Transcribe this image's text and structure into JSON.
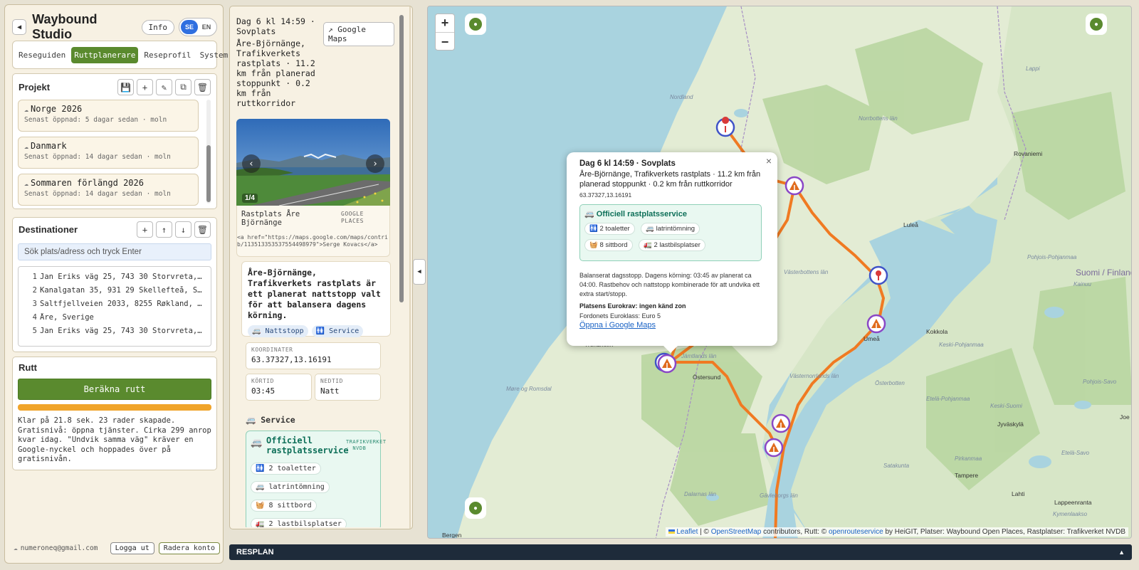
{
  "app": {
    "title": "Waybound Studio",
    "back_icon": "◀",
    "info_label": "Info",
    "lang_se": "SE",
    "lang_en": "EN"
  },
  "tabs": [
    {
      "label": "Reseguiden"
    },
    {
      "label": "Ruttplanerare"
    },
    {
      "label": "Reseprofil"
    },
    {
      "label": "System"
    }
  ],
  "projects": {
    "title": "Projekt",
    "items": [
      {
        "name": "Norge 2026",
        "meta": "Senast öppnad: 5 dagar sedan · moln"
      },
      {
        "name": "Danmark",
        "meta": "Senast öppnad: 14 dagar sedan · moln"
      },
      {
        "name": "Sommaren förlängd 2026",
        "meta": "Senast öppnad: 14 dagar sedan · moln"
      }
    ]
  },
  "destinations": {
    "title": "Destinationer",
    "search_placeholder": "Sök plats/adress och tryck Enter",
    "items": [
      {
        "num": "1",
        "address": "Jan Eriks väg 25, 743 30 Storvreta, Sverige"
      },
      {
        "num": "2",
        "address": "Kanalgatan 35, 931 29 Skellefteå, Sverige"
      },
      {
        "num": "3",
        "address": "Saltfjellveien 2033, 8255 Røkland, Norge"
      },
      {
        "num": "4",
        "address": "Åre, Sverige"
      },
      {
        "num": "5",
        "address": "Jan Eriks väg 25, 743 30 Storvreta, Sverige"
      }
    ]
  },
  "route": {
    "title": "Rutt",
    "calc_label": "Beräkna rutt",
    "progress": 1.0,
    "status": "Klar på 21.8 sek. 23 rader skapade. Gratisnivå: öppna tjänster. Cirka 299 anrop kvar idag. \"Undvik samma väg\" kräver en Google-nyckel och hoppades över på gratisnivån."
  },
  "footer": {
    "email": "numeroneq@gmail.com",
    "logout_label": "Logga ut",
    "delete_label": "Radera konto"
  },
  "detail": {
    "title": "Dag 6 kl 14:59 · Sovplats",
    "subtitle": "Åre-Björnänge, Trafikverkets rastplats · 11.2 km från planerad stoppunkt · 0.2 km från ruttkorridor",
    "gmaps_label": "↗ Google Maps",
    "photo_counter": "1/4",
    "photo_caption": "Rastplats Åre Björnänge",
    "photo_source": "GOOGLE PLACES",
    "photo_attribution": "<a href=\"https://maps.google.com/maps/contrib/113513353537554498979\">Serge Kovacs</a>",
    "description": "Åre-Björnänge, Trafikverkets rastplats är ett planerat nattstopp valt för att balansera dagens körning.",
    "chip_1": "Nattstopp",
    "chip_2": "Service",
    "coord_label": "KOORDINATER",
    "coord_value": "63.37327,13.16191",
    "drive_label": "KÖRTID",
    "drive_value": "03:45",
    "down_label": "NEDTID",
    "down_value": "Natt",
    "service_head": "Service",
    "service_title": "Officiell rastplatsservice",
    "service_source": "TRAFIKVERKET · NVDB",
    "services": [
      "2 toaletter",
      "latrintömning",
      "8 sittbord",
      "2 lastbilsplatser"
    ]
  },
  "popup": {
    "title": "Dag 6 kl 14:59 · Sovplats",
    "subtitle": "Åre-Björnänge, Trafikverkets rastplats · 11.2 km från planerad stoppunkt · 0.2 km från ruttkorridor",
    "coord": "63.37327,13.16191",
    "service_title": "Officiell rastplatsservice",
    "body": "Balanserat dagsstopp. Dagens körning: 03:45 av planerat ca 04:00. Rastbehov och nattstopp kombinerade för att undvika ett extra start/stopp.",
    "euro_req": "Platsens Eurokrav: ingen känd zon",
    "euro_class": "Fordonets Euroklass: Euro 5",
    "link": "Öppna i Google Maps"
  },
  "map": {
    "zoom_in": "+",
    "zoom_out": "−",
    "attribution_prefix": "Leaflet",
    "attribution_osm": "OpenStreetMap",
    "attribution_mid": " contributors, Rutt: © ",
    "attribution_ors": "openrouteservice",
    "attribution_rest": " by HeiGIT, Platser: Waybound Open Places, Rastplatser: Trafikverket NVDB",
    "labels": {
      "nordland": "Nordland",
      "norrbotten": "Norrbottens län",
      "lappi": "Lappi",
      "rovaniemi": "Rovaniemi",
      "lulea": "Luleå",
      "pohjois": "Pohjois-Pohjanmaa",
      "suomi": "Suomi / Finland",
      "kainuu": "Kainuu",
      "vasterbotten": "Västerbottens län",
      "umea": "Umeå",
      "kokkola": "Kokkola",
      "keski_pohjanmaa": "Keski-Pohjanmaa",
      "trondheim": "Trondheim",
      "jamtland": "Jämtlands län",
      "ostersund": "Östersund",
      "vasternorrland": "Västernorrlands län",
      "osterbotten": "Österbotten",
      "etela_pohjanmaa": "Etelä-Pohjanmaa",
      "keski_suomi": "Keski-Suomi",
      "jyvaskyla": "Jyväskylä",
      "more": "Møre og Romsdal",
      "satakunta": "Satakunta",
      "pirkanmaa": "Pirkanmaa",
      "tampere": "Tampere",
      "pohjois_savo": "Pohjois-Savo",
      "etela_savo": "Etelä-Savo",
      "gavleborg": "Gävleborgs län",
      "dalarnas": "Dalarnas län",
      "lahti": "Lahti",
      "lappeenranta": "Lappeenranta",
      "kymenlaakso": "Kymenlaakso",
      "bergen": "Bergen",
      "joensuu": "Joe"
    }
  },
  "resplan": {
    "label": "RESPLAN",
    "caret": "▲"
  }
}
